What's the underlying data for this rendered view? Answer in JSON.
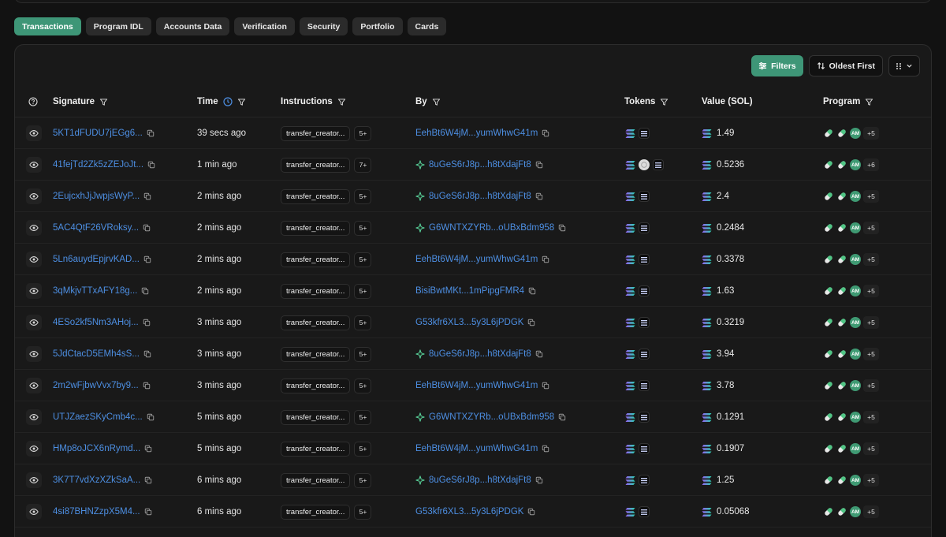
{
  "tabs": [
    {
      "label": "Transactions",
      "active": true
    },
    {
      "label": "Program IDL",
      "active": false
    },
    {
      "label": "Accounts Data",
      "active": false
    },
    {
      "label": "Verification",
      "active": false
    },
    {
      "label": "Security",
      "active": false
    },
    {
      "label": "Portfolio",
      "active": false
    },
    {
      "label": "Cards",
      "active": false
    }
  ],
  "toolbar": {
    "filters_label": "Filters",
    "sort_label": "Oldest First"
  },
  "columns": {
    "signature": "Signature",
    "time": "Time",
    "instructions": "Instructions",
    "by": "By",
    "tokens": "Tokens",
    "value": "Value (SOL)",
    "program": "Program"
  },
  "colors": {
    "accent": "#3e9677",
    "link": "#4d8fe3",
    "background": "#121212"
  },
  "rows": [
    {
      "signature": "5KT1dFUDU7jEGg6...",
      "time": "39 secs ago",
      "instruction": "transfer_creator...",
      "instr_more": "5+",
      "by": "EehBt6W4jM...yumWhwG41m",
      "by_icon": false,
      "tokens": [
        "sol",
        "dark"
      ],
      "value": "1.49",
      "program_more": "+5"
    },
    {
      "signature": "41fejTd2Zk5zZEJoJt...",
      "time": "1 min ago",
      "instruction": "transfer_creator...",
      "instr_more": "7+",
      "by": "8uGeS6rJ8p...h8tXdajFt8",
      "by_icon": true,
      "tokens": [
        "sol",
        "usdc",
        "dark"
      ],
      "value": "0.5236",
      "program_more": "+6"
    },
    {
      "signature": "2EujcxhJjJwpjsWyP...",
      "time": "2 mins ago",
      "instruction": "transfer_creator...",
      "instr_more": "5+",
      "by": "8uGeS6rJ8p...h8tXdajFt8",
      "by_icon": true,
      "tokens": [
        "sol",
        "dark"
      ],
      "value": "2.4",
      "program_more": "+5"
    },
    {
      "signature": "5AC4QtF26VRoksy...",
      "time": "2 mins ago",
      "instruction": "transfer_creator...",
      "instr_more": "5+",
      "by": "G6WNTXZYRb...oUBxBdm958",
      "by_icon": true,
      "tokens": [
        "sol",
        "dark"
      ],
      "value": "0.2484",
      "program_more": "+5"
    },
    {
      "signature": "5Ln6auydEpjrvKAD...",
      "time": "2 mins ago",
      "instruction": "transfer_creator...",
      "instr_more": "5+",
      "by": "EehBt6W4jM...yumWhwG41m",
      "by_icon": false,
      "tokens": [
        "sol",
        "dark"
      ],
      "value": "0.3378",
      "program_more": "+5"
    },
    {
      "signature": "3qMkjvTTxAFY18g...",
      "time": "2 mins ago",
      "instruction": "transfer_creator...",
      "instr_more": "5+",
      "by": "BisiBwtMKt...1mPipgFMR4",
      "by_icon": false,
      "tokens": [
        "sol",
        "dark"
      ],
      "value": "1.63",
      "program_more": "+5"
    },
    {
      "signature": "4ESo2kf5Nm3AHoj...",
      "time": "3 mins ago",
      "instruction": "transfer_creator...",
      "instr_more": "5+",
      "by": "G53kfr6XL3...5y3L6jPDGK",
      "by_icon": false,
      "tokens": [
        "sol",
        "dark"
      ],
      "value": "0.3219",
      "program_more": "+5"
    },
    {
      "signature": "5JdCtacD5EMh4sS...",
      "time": "3 mins ago",
      "instruction": "transfer_creator...",
      "instr_more": "5+",
      "by": "8uGeS6rJ8p...h8tXdajFt8",
      "by_icon": true,
      "tokens": [
        "sol",
        "dark"
      ],
      "value": "3.94",
      "program_more": "+5"
    },
    {
      "signature": "2m2wFjbwVvx7by9...",
      "time": "3 mins ago",
      "instruction": "transfer_creator...",
      "instr_more": "5+",
      "by": "EehBt6W4jM...yumWhwG41m",
      "by_icon": false,
      "tokens": [
        "sol",
        "dark"
      ],
      "value": "3.78",
      "program_more": "+5"
    },
    {
      "signature": "UTJZaezSKyCmb4c...",
      "time": "5 mins ago",
      "instruction": "transfer_creator...",
      "instr_more": "5+",
      "by": "G6WNTXZYRb...oUBxBdm958",
      "by_icon": true,
      "tokens": [
        "sol",
        "dark"
      ],
      "value": "0.1291",
      "program_more": "+5"
    },
    {
      "signature": "HMp8oJCX6nRymd...",
      "time": "5 mins ago",
      "instruction": "transfer_creator...",
      "instr_more": "5+",
      "by": "EehBt6W4jM...yumWhwG41m",
      "by_icon": false,
      "tokens": [
        "sol",
        "dark"
      ],
      "value": "0.1907",
      "program_more": "+5"
    },
    {
      "signature": "3K7T7vdXzXZkSaA...",
      "time": "6 mins ago",
      "instruction": "transfer_creator...",
      "instr_more": "5+",
      "by": "8uGeS6rJ8p...h8tXdajFt8",
      "by_icon": true,
      "tokens": [
        "sol",
        "dark"
      ],
      "value": "1.25",
      "program_more": "+5"
    },
    {
      "signature": "4si87BHNZzpX5M4...",
      "time": "6 mins ago",
      "instruction": "transfer_creator...",
      "instr_more": "5+",
      "by": "G53kfr6XL3...5y3L6jPDGK",
      "by_icon": false,
      "tokens": [
        "sol",
        "dark"
      ],
      "value": "0.05068",
      "program_more": "+5"
    }
  ]
}
